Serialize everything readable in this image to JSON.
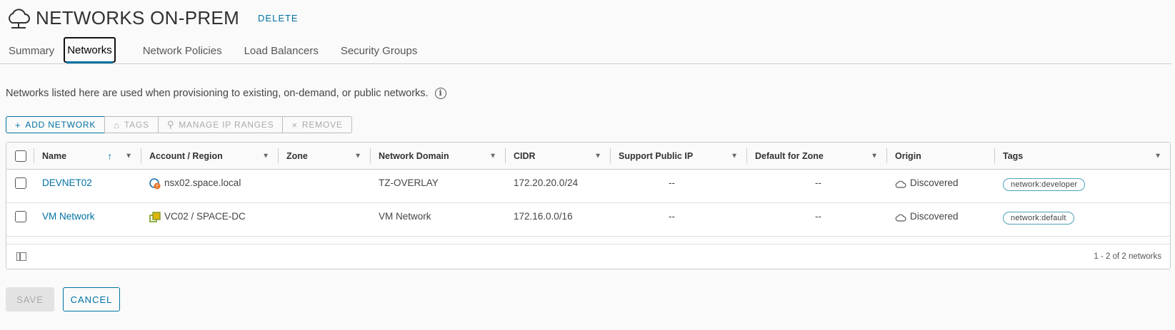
{
  "header": {
    "title": "NETWORKS ON-PREM",
    "delete_label": "DELETE",
    "icon": "cloud-icon"
  },
  "tabs": [
    {
      "label": "Summary"
    },
    {
      "label": "Networks",
      "active": true
    },
    {
      "label": "Network Policies"
    },
    {
      "label": "Load Balancers"
    },
    {
      "label": "Security Groups"
    }
  ],
  "description": "Networks listed here are used when provisioning to existing, on-demand, or public networks.",
  "toolbar": {
    "add_network": "ADD NETWORK",
    "tags": "TAGS",
    "manage_ip_ranges": "MANAGE IP RANGES",
    "remove": "REMOVE"
  },
  "grid": {
    "columns": [
      "Name",
      "Account / Region",
      "Zone",
      "Network Domain",
      "CIDR",
      "Support Public IP",
      "Default for Zone",
      "Origin",
      "Tags"
    ],
    "rows": [
      {
        "name": "DEVNET02",
        "account": "nsx02.space.local",
        "account_icon": "nsx-icon",
        "zone": "",
        "network_domain": "TZ-OVERLAY",
        "cidr": "172.20.20.0/24",
        "support_public_ip": "--",
        "default_for_zone": "--",
        "origin": "Discovered",
        "tag": "network:developer"
      },
      {
        "name": "VM Network",
        "account": "VC02 / SPACE-DC",
        "account_icon": "vcenter-icon",
        "zone": "",
        "network_domain": "VM Network",
        "cidr": "172.16.0.0/16",
        "support_public_ip": "--",
        "default_for_zone": "--",
        "origin": "Discovered",
        "tag": "network:default"
      }
    ],
    "pagination": "1 - 2 of 2 networks"
  },
  "footer": {
    "save_label": "SAVE",
    "cancel_label": "CANCEL"
  },
  "colors": {
    "accent": "#0072a3",
    "tag_border": "#4aa3b8"
  }
}
